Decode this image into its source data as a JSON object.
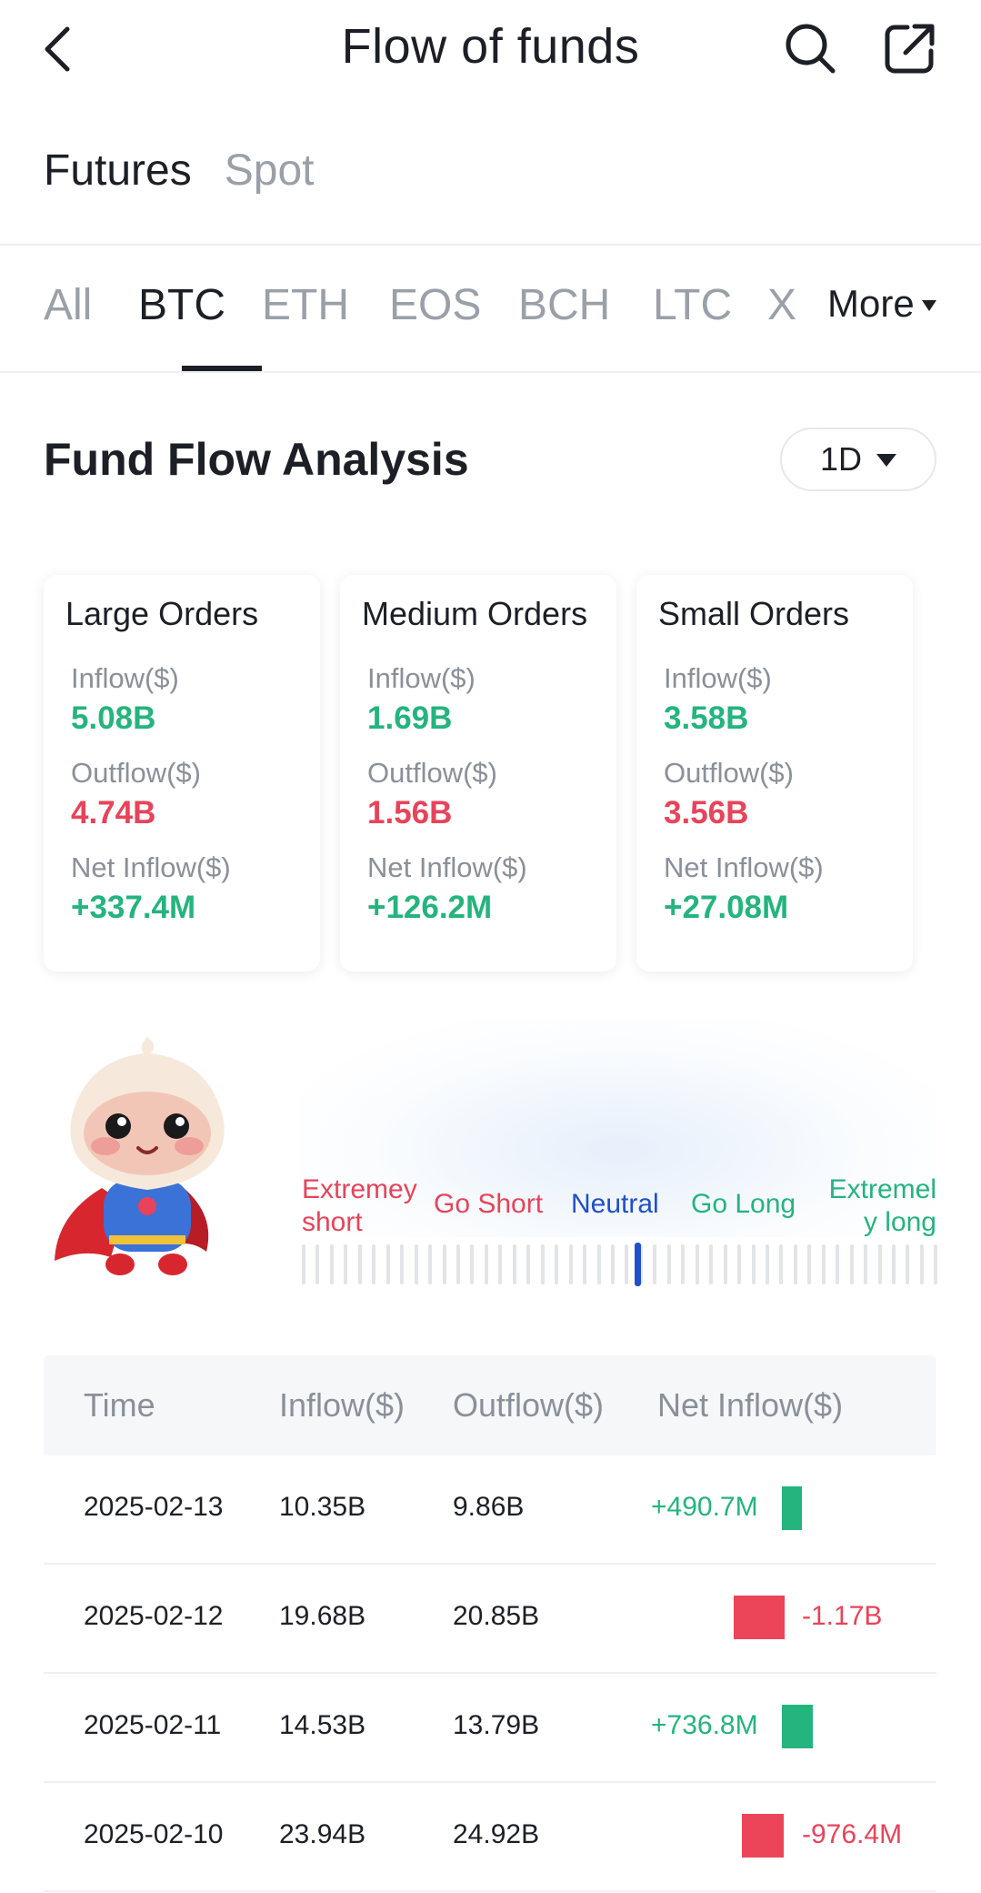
{
  "header": {
    "title": "Flow of funds"
  },
  "market_tabs": [
    "Futures",
    "Spot"
  ],
  "coin_tabs": [
    "All",
    "BTC",
    "ETH",
    "EOS",
    "BCH",
    "LTC",
    "X"
  ],
  "more_label": "More",
  "section": {
    "title": "Fund Flow Analysis",
    "period": "1D"
  },
  "cards": [
    {
      "title": "Large Orders",
      "inflow_label": "Inflow($)",
      "inflow": "5.08B",
      "outflow_label": "Outflow($)",
      "outflow": "4.74B",
      "net_label": "Net Inflow($)",
      "net": "+337.4M"
    },
    {
      "title": "Medium Orders",
      "inflow_label": "Inflow($)",
      "inflow": "1.69B",
      "outflow_label": "Outflow($)",
      "outflow": "1.56B",
      "net_label": "Net Inflow($)",
      "net": "+126.2M"
    },
    {
      "title": "Small Orders",
      "inflow_label": "Inflow($)",
      "inflow": "3.58B",
      "outflow_label": "Outflow($)",
      "outflow": "3.56B",
      "net_label": "Net Inflow($)",
      "net": "+27.08M"
    }
  ],
  "sentiment": {
    "labels": [
      "Extremey short",
      "Go Short",
      "Neutral",
      "Go Long",
      "Extremely long"
    ],
    "label_lines": [
      [
        "Extremey",
        "short"
      ],
      [
        "Go Short"
      ],
      [
        "Neutral"
      ],
      [
        "Go Long"
      ],
      [
        "Extremel",
        "y long"
      ]
    ],
    "current": "Neutral"
  },
  "table": {
    "headers": [
      "Time",
      "Inflow($)",
      "Outflow($)",
      "Net Inflow($)"
    ],
    "rows": [
      {
        "time": "2025-02-13",
        "inflow": "10.35B",
        "outflow": "9.86B",
        "net": "+490.7M",
        "net_value_m": 490.7
      },
      {
        "time": "2025-02-12",
        "inflow": "19.68B",
        "outflow": "20.85B",
        "net": "-1.17B",
        "net_value_m": -1170
      },
      {
        "time": "2025-02-11",
        "inflow": "14.53B",
        "outflow": "13.79B",
        "net": "+736.8M",
        "net_value_m": 736.8
      },
      {
        "time": "2025-02-10",
        "inflow": "23.94B",
        "outflow": "24.92B",
        "net": "-976.4M",
        "net_value_m": -976.4
      }
    ]
  },
  "colors": {
    "positive": "#24b47e",
    "negative": "#e8435a",
    "neutral": "#1f4fc9",
    "text": "#1c1f26",
    "muted": "#9aa0a8"
  }
}
